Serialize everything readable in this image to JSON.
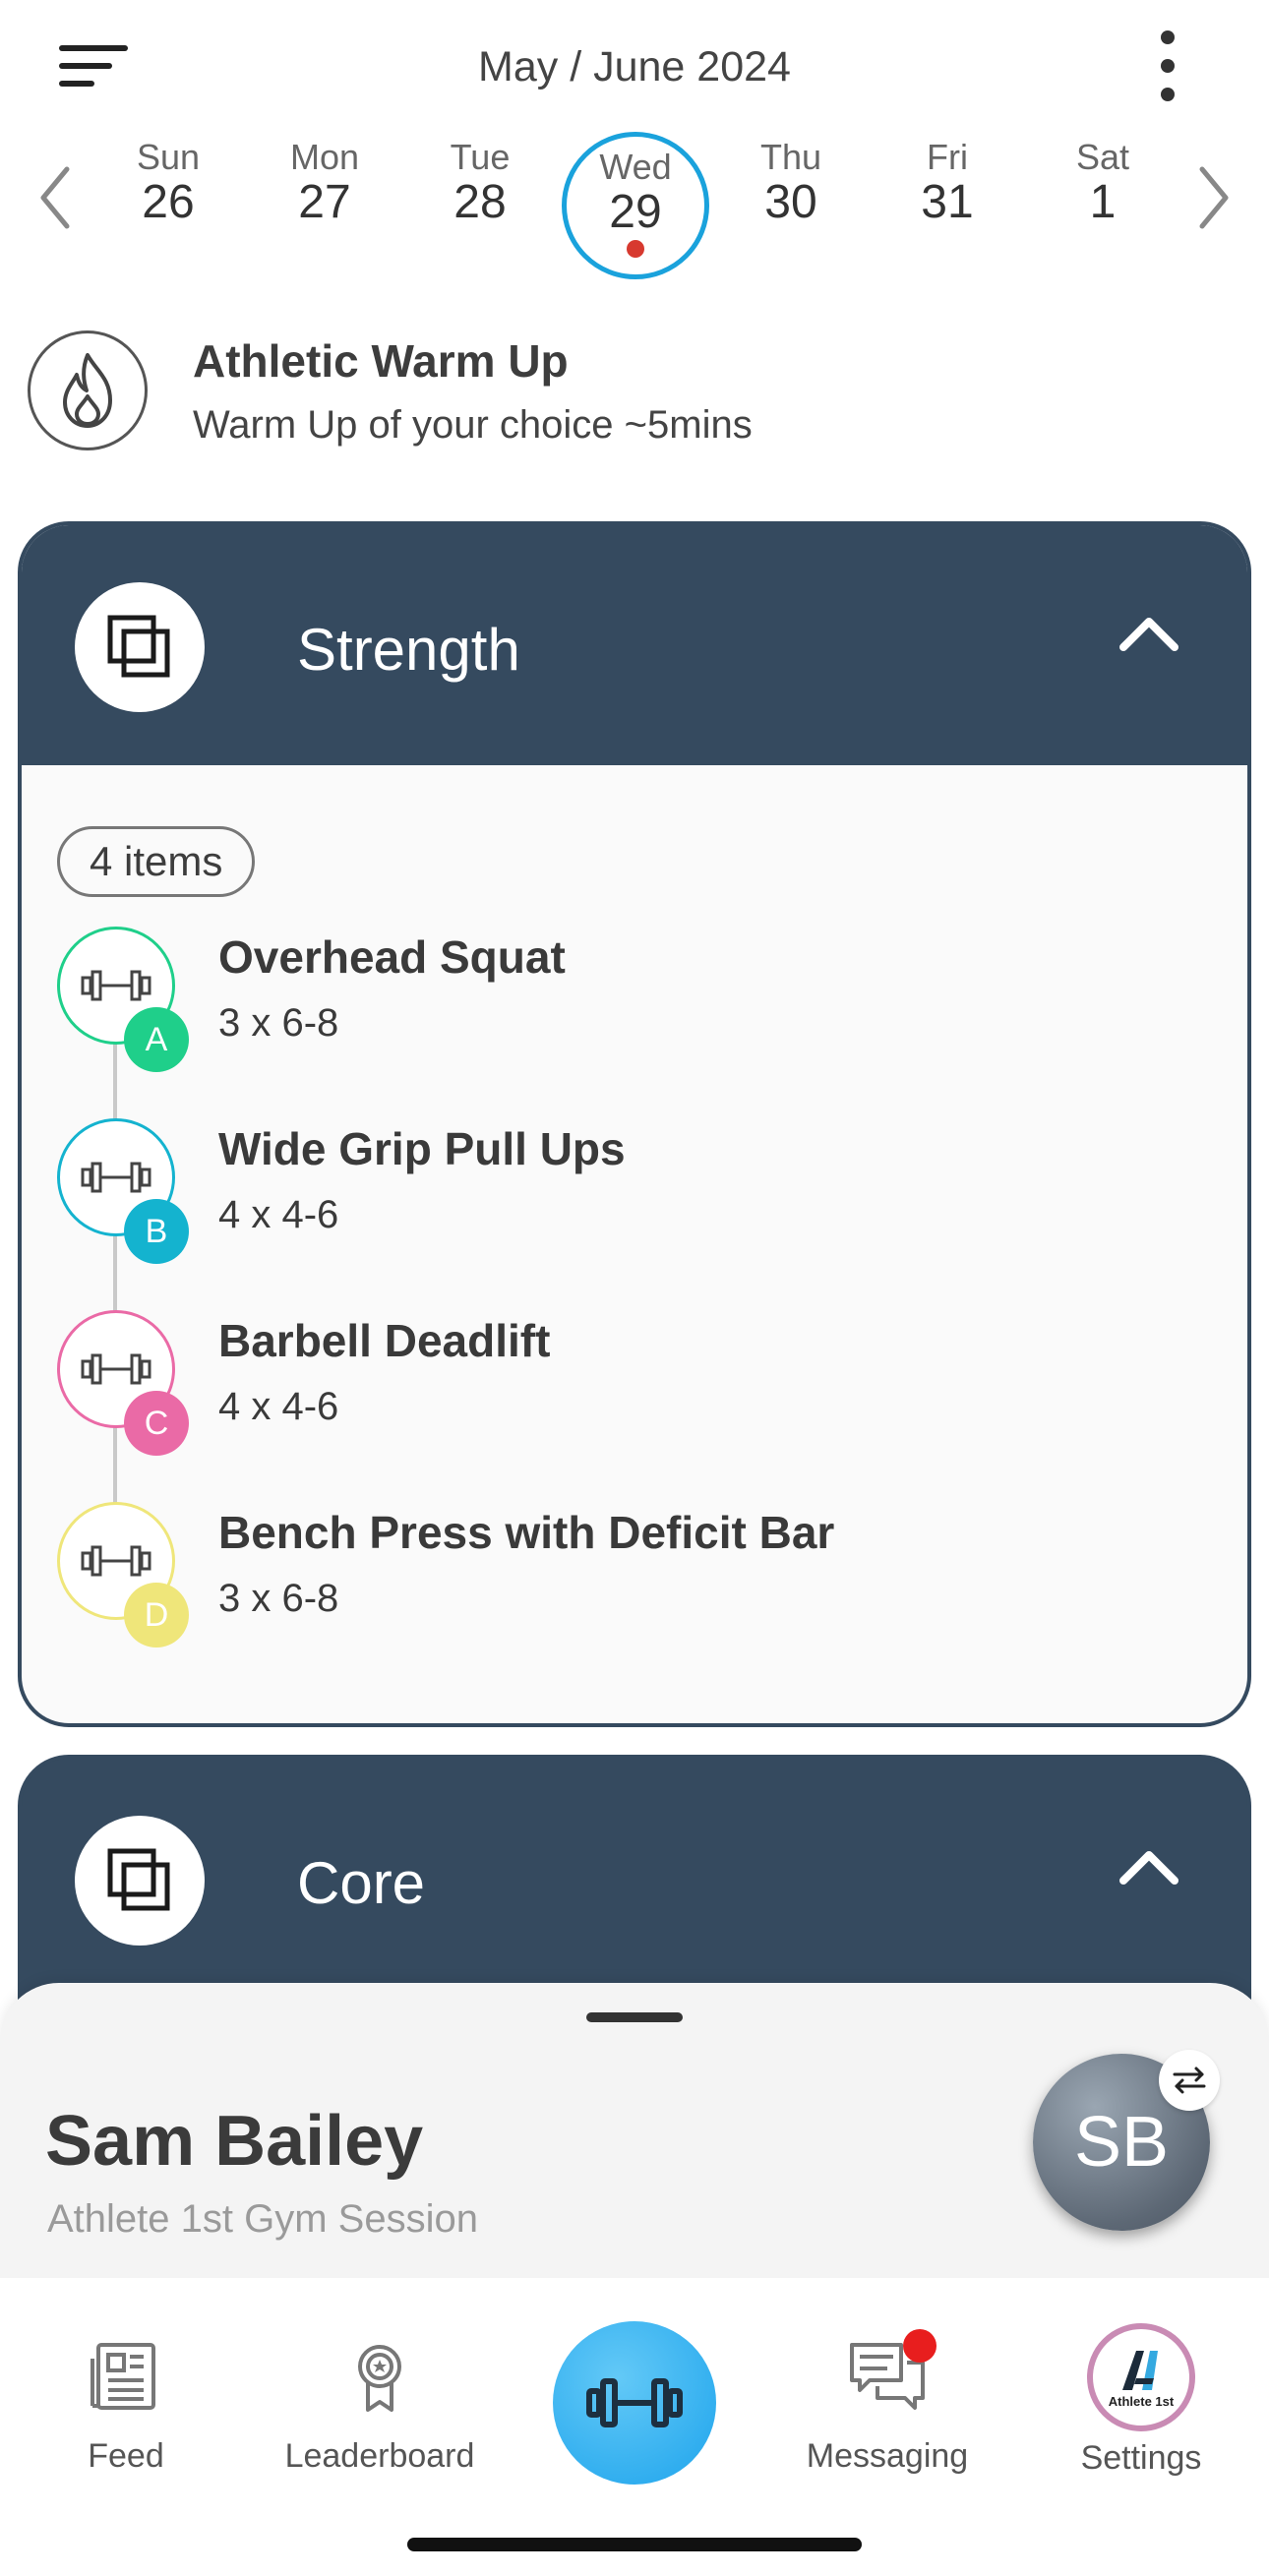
{
  "header": {
    "title": "May / June 2024"
  },
  "week": {
    "days": [
      {
        "name": "Sun",
        "num": "26"
      },
      {
        "name": "Mon",
        "num": "27"
      },
      {
        "name": "Tue",
        "num": "28"
      },
      {
        "name": "Wed",
        "num": "29",
        "selected": true
      },
      {
        "name": "Thu",
        "num": "30"
      },
      {
        "name": "Fri",
        "num": "31"
      },
      {
        "name": "Sat",
        "num": "1"
      }
    ]
  },
  "warmup": {
    "title": "Athletic Warm Up",
    "subtitle": "Warm Up of your choice ~5mins",
    "icon": "flame-icon"
  },
  "strength": {
    "title": "Strength",
    "count_label": "4 items",
    "exercises": [
      {
        "badge": "A",
        "name": "Overhead Squat",
        "sets": "3 x 6-8",
        "color": "#1fcf8a"
      },
      {
        "badge": "B",
        "name": "Wide Grip Pull Ups",
        "sets": "4 x 4-6",
        "color": "#14b3cf"
      },
      {
        "badge": "C",
        "name": "Barbell Deadlift",
        "sets": "4 x 4-6",
        "color": "#ea6aa6"
      },
      {
        "badge": "D",
        "name": "Bench Press with Deficit Bar",
        "sets": "3 x 6-8",
        "color": "#efe67a"
      }
    ]
  },
  "core": {
    "title": "Core"
  },
  "sheet": {
    "name": "Sam Bailey",
    "subtitle": "Athlete 1st Gym Session",
    "initials": "SB"
  },
  "nav": {
    "items": [
      {
        "label": "Feed",
        "icon": "newspaper-icon"
      },
      {
        "label": "Leaderboard",
        "icon": "award-ribbon-icon"
      },
      {
        "label": "",
        "icon": "dumbbell-icon"
      },
      {
        "label": "Messaging",
        "icon": "chat-icon"
      },
      {
        "label": "Settings",
        "icon": "athlete-logo-icon"
      }
    ],
    "settings_logo_text": "Athlete 1st"
  },
  "colors": {
    "primary_dark": "#354a5f",
    "accent_blue": "#1aa2dc",
    "notification_red": "#e81e1e"
  }
}
